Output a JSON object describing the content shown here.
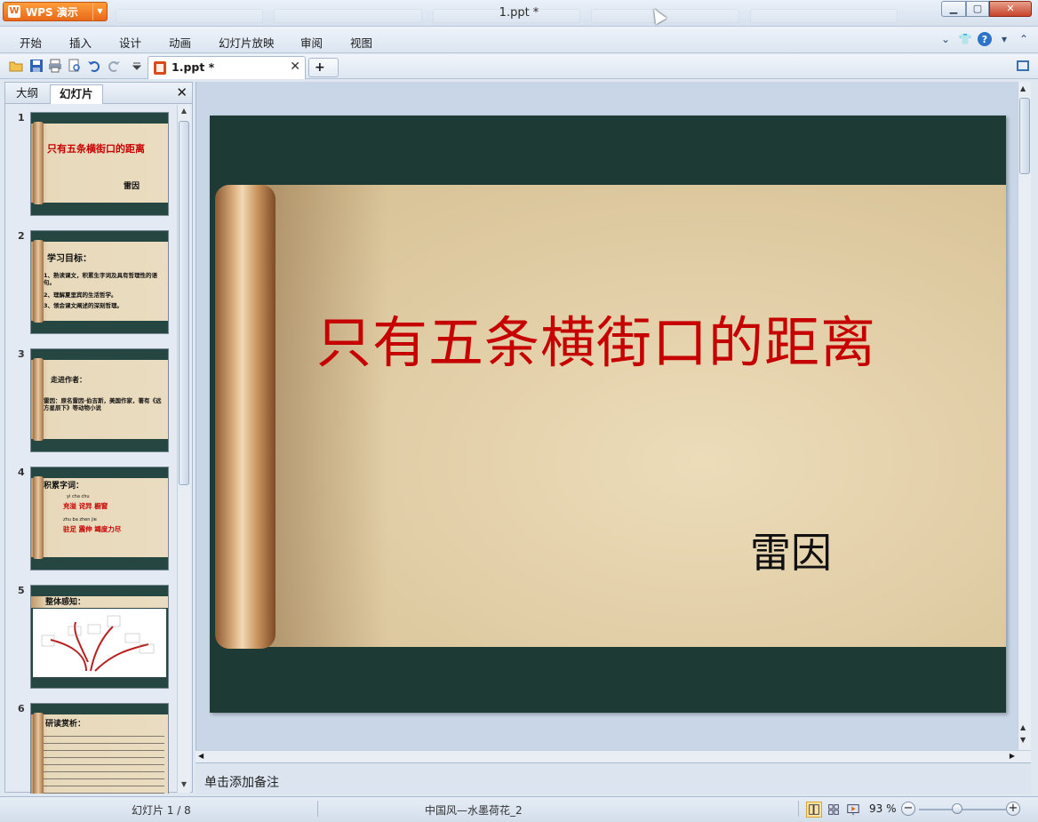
{
  "app": {
    "brand_label": "WPS 演示",
    "window_title": "1.ppt *"
  },
  "menu": {
    "items": [
      "开始",
      "插入",
      "设计",
      "动画",
      "幻灯片放映",
      "审阅",
      "视图"
    ]
  },
  "toolbar": {
    "doc_tab_label": "1.ppt *",
    "new_tab_label": "+"
  },
  "panel": {
    "tabs": [
      "大纲",
      "幻灯片"
    ],
    "active_tab": "幻灯片"
  },
  "thumbnails": [
    {
      "num": "1",
      "title": "只有五条横街口的距离",
      "author": "雷因"
    },
    {
      "num": "2",
      "title": "学习目标：",
      "lines": [
        "1、熟读课文，积累生字词及具有哲理性的语句。",
        "2、理解夏里宾的生活哲学。",
        "3、领会课文阐述的深刻哲理。"
      ]
    },
    {
      "num": "3",
      "title": "走进作者：",
      "lines": [
        "雷因：原名雷因·伯吉斯，美国作家，著有《远方星辰下》等动物小说"
      ]
    },
    {
      "num": "4",
      "title": "积累字词：",
      "lines": [
        "yi   cha   chu",
        "充溢   诧异   橱窗",
        "zhu ba   zhen   jie",
        "驻足   震伸   竭度力尽"
      ]
    },
    {
      "num": "5",
      "title": "整体感知："
    },
    {
      "num": "6",
      "title": "研读赏析："
    }
  ],
  "slide": {
    "title": "只有五条横街口的距离",
    "author": "雷因"
  },
  "notes": {
    "placeholder": "单击添加备注"
  },
  "status": {
    "slide_counter": "幻灯片 1 / 8",
    "theme_name": "中国风—水墨荷花_2",
    "zoom_label": "93 %",
    "zoom_percent": 93
  },
  "colors": {
    "title_red": "#c60000",
    "slide_bg": "#1e3a35",
    "brand_orange": "#e8691a"
  }
}
